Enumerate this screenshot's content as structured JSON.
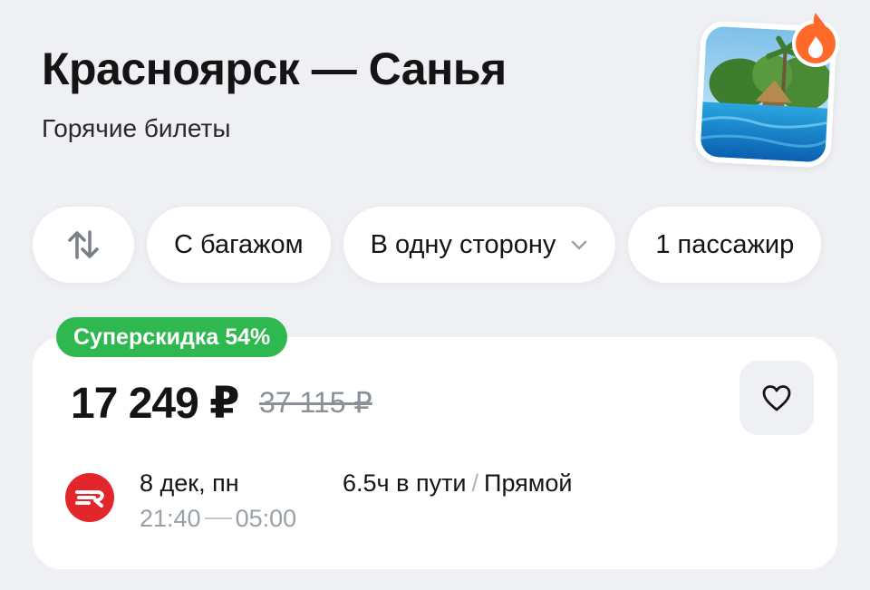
{
  "header": {
    "title": "Красноярск — Санья",
    "subtitle": "Горячие билеты"
  },
  "promo_image": {
    "icon": "fire-icon"
  },
  "filters": {
    "swap_icon": "swap-arrows-icon",
    "baggage": "С багажом",
    "trip_type": "В одну сторону",
    "passengers": "1 пассажир"
  },
  "ticket": {
    "badge": "Суперскидка 54%",
    "price": "17 249 ₽",
    "old_price": "37 115 ₽",
    "favorite_icon": "heart-icon",
    "airline_icon": "airline-logo-icon",
    "date": "8 дек, пн",
    "depart": "21:40",
    "arrive": "05:00",
    "duration": "6.5ч в пути",
    "separator": "/",
    "stops": "Прямой"
  },
  "colors": {
    "background": "#eef0f4",
    "badge_green": "#2fb84f",
    "airline_red": "#e3262c",
    "fire_orange": "#ff6a2a"
  }
}
